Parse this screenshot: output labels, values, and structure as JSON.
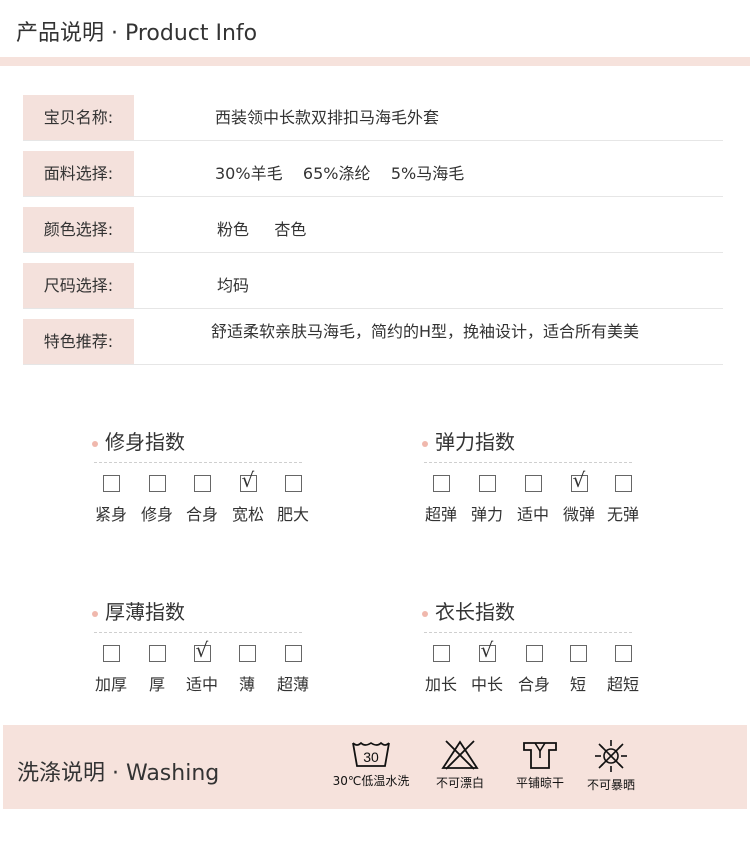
{
  "header": {
    "title": "产品说明 · Product Info"
  },
  "info": [
    {
      "label": "宝贝名称:",
      "value": "西装领中长款双排扣马海毛外套"
    },
    {
      "label": "面料选择:",
      "value": "30%羊毛    65%涤纶    5%马海毛"
    },
    {
      "label": "颜色选择:",
      "value": "粉色     杏色"
    },
    {
      "label": "尺码选择:",
      "value": "均码"
    },
    {
      "label": "特色推荐:",
      "value": "舒适柔软亲肤马海毛，简约的H型，挽袖设计，适合所有美美"
    }
  ],
  "indices": [
    {
      "title": "修身指数",
      "options": [
        "紧身",
        "修身",
        "合身",
        "宽松",
        "肥大"
      ],
      "checked": 3
    },
    {
      "title": "弹力指数",
      "options": [
        "超弹",
        "弹力",
        "适中",
        "微弹",
        "无弹"
      ],
      "checked": 3
    },
    {
      "title": "厚薄指数",
      "options": [
        "加厚",
        "厚",
        "适中",
        "薄",
        "超薄"
      ],
      "checked": 2
    },
    {
      "title": "衣长指数",
      "options": [
        "加长",
        "中长",
        "合身",
        "短",
        "超短"
      ],
      "checked": 1
    }
  ],
  "check_mark": "√",
  "washing": {
    "title": "洗涤说明 · Washing",
    "items": [
      {
        "icon": "wash-30-icon",
        "label": "30℃低温水洗",
        "temp": "30"
      },
      {
        "icon": "no-bleach-icon",
        "label": "不可漂白"
      },
      {
        "icon": "flat-dry-icon",
        "label": "平铺晾干"
      },
      {
        "icon": "no-sun-icon",
        "label": "不可暴晒"
      }
    ]
  },
  "colors": {
    "accent": "#f6e2dc",
    "label_bg": "#f4e1dc",
    "dot": "#f0b8ad"
  }
}
